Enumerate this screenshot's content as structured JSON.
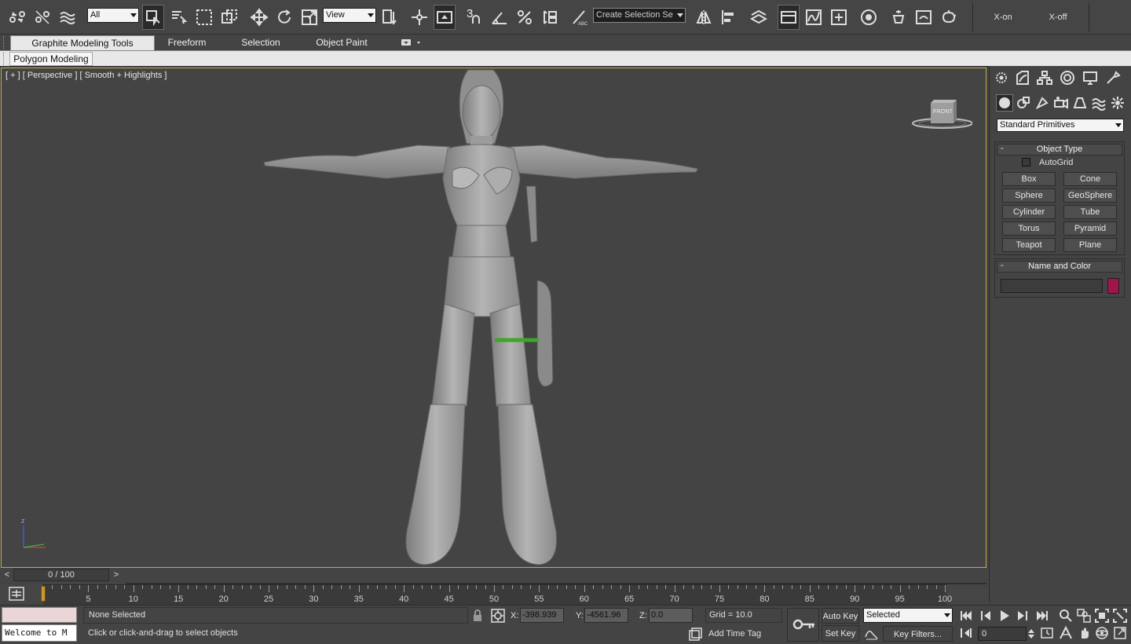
{
  "toolbar": {
    "selection_filter": "All",
    "ref_coord": "View",
    "named_selection": "Create Selection Se",
    "snap_3": "3",
    "x_on": "X-on",
    "x_off": "X-off"
  },
  "ribbon": {
    "tabs": [
      "Graphite Modeling Tools",
      "Freeform",
      "Selection",
      "Object Paint"
    ],
    "active_tab": "Graphite Modeling Tools",
    "sub_tab": "Polygon Modeling"
  },
  "viewport": {
    "label": "[ + ] [ Perspective ] [ Smooth + Highlights ]",
    "viewcube_face": "FRONT",
    "axis_z": "z",
    "border_color": "#c8a64b"
  },
  "command_panel": {
    "category": "Standard Primitives",
    "object_type_title": "Object Type",
    "autogrid": "AutoGrid",
    "buttons": [
      "Box",
      "Cone",
      "Sphere",
      "GeoSphere",
      "Cylinder",
      "Tube",
      "Torus",
      "Pyramid",
      "Teapot",
      "Plane"
    ],
    "name_color_title": "Name and Color",
    "object_name": "",
    "object_color": "#a0154a",
    "rollout_minus": "-"
  },
  "timeline": {
    "slider_label": "0 / 100",
    "prev": "<",
    "next": ">",
    "ticks": [
      "5",
      "10",
      "15",
      "20",
      "25",
      "30",
      "35",
      "40",
      "45",
      "50",
      "55",
      "60",
      "65",
      "70",
      "75",
      "80",
      "85",
      "90",
      "95",
      "100"
    ]
  },
  "status": {
    "selection": "None Selected",
    "prompt": "Click or click-and-drag to select objects",
    "maxscript": "Welcome to M",
    "x_label": "X:",
    "x_value": "-398.939",
    "y_label": "Y:",
    "y_value": "-4561.96",
    "z_label": "Z:",
    "z_value": "0.0",
    "grid": "Grid = 10.0",
    "add_time_tag": "Add Time Tag",
    "auto_key": "Auto Key",
    "set_key": "Set Key",
    "key_mode": "Selected",
    "key_filters": "Key Filters...",
    "frame": "0"
  }
}
